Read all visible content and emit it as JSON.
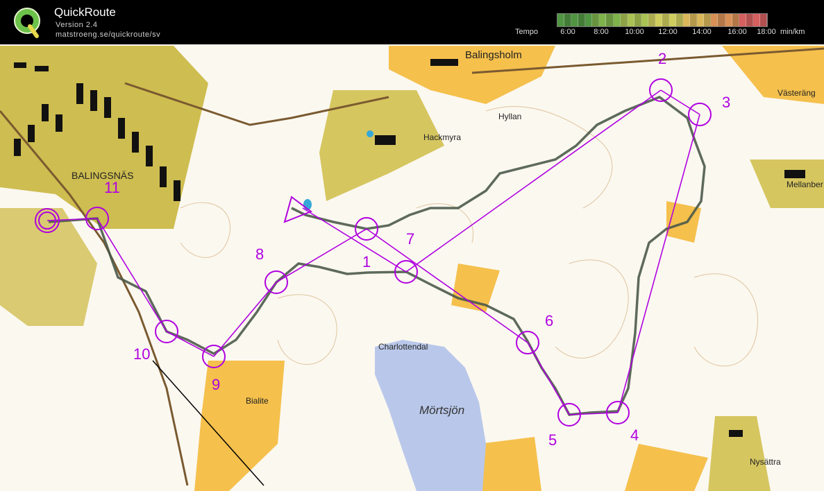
{
  "app": {
    "title": "QuickRoute",
    "version": "Version 2.4",
    "url": "matstroeng.se/quickroute/sv"
  },
  "tempo": {
    "label": "Tempo",
    "unit": "min/km",
    "ticks": [
      "6:00",
      "8:00",
      "10:00",
      "12:00",
      "14:00",
      "16:00",
      "18:00"
    ]
  },
  "colors": {
    "course": "#b000e0",
    "route": "#4b5a4a",
    "water": "#b9c8ea",
    "open_land": "#f6c04e",
    "settlement": "#c8b43c",
    "buildings": "#111111",
    "gradient": [
      "#5aa64a",
      "#8cc654",
      "#bcd85c",
      "#e6e468",
      "#f2cc64",
      "#f0a060",
      "#ee6a6a"
    ]
  },
  "map": {
    "place_names": [
      "Balingsholm",
      "Hyllan",
      "Hackmyra",
      "Västeräng",
      "Mellanber",
      "BALINGSNÄS",
      "Charlottendal",
      "Mörtsjön",
      "Bialite",
      "Nysättra"
    ],
    "control_numbers": [
      "1",
      "2",
      "3",
      "4",
      "5",
      "6",
      "7",
      "8",
      "9",
      "10",
      "11"
    ]
  }
}
